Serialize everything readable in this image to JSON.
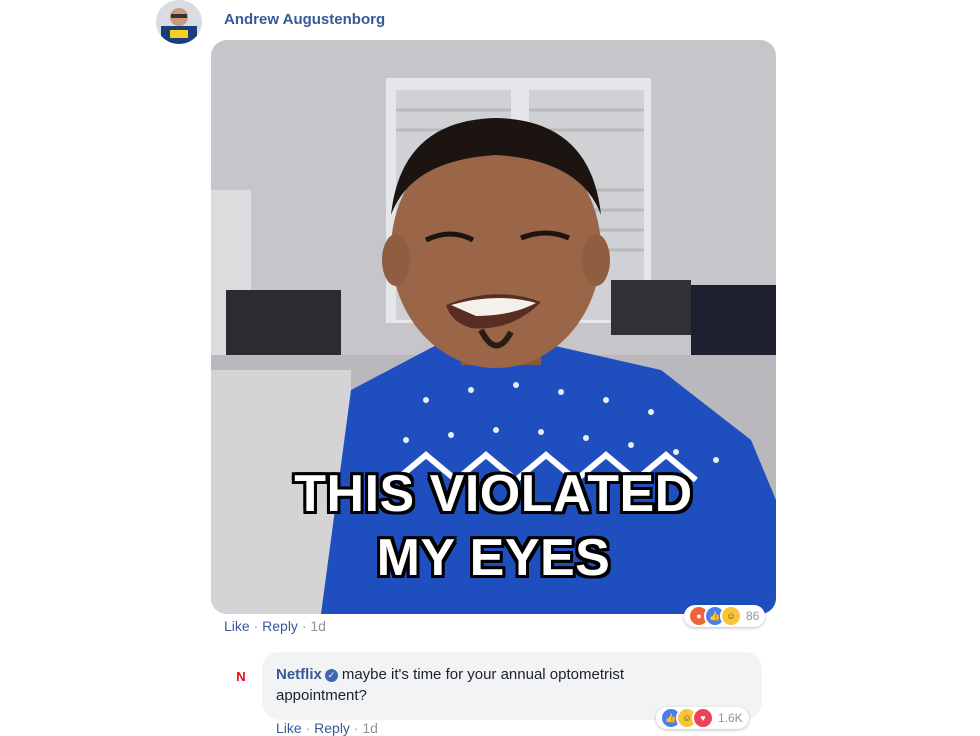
{
  "comment": {
    "author": "Andrew Augustenborg",
    "gif_caption_line1": "THIS VIOLATED",
    "gif_caption_line2": "MY EYES",
    "actions": {
      "like": "Like",
      "reply": "Reply",
      "time": "1d",
      "sep": "·"
    },
    "reactions": {
      "count": "86",
      "types": [
        "angry-icon",
        "like-icon",
        "haha-icon"
      ]
    }
  },
  "reply": {
    "author": "Netflix",
    "logo_letter": "N",
    "text": "maybe it's time for your annual optometrist appointment?",
    "actions": {
      "like": "Like",
      "reply": "Reply",
      "time": "1d",
      "sep": "·"
    },
    "reactions": {
      "count": "1.6K",
      "types": [
        "like-icon",
        "haha-icon",
        "love-icon"
      ]
    }
  },
  "colors": {
    "link": "#385898",
    "meta": "#90949c",
    "bubble": "#f2f3f5",
    "sweater": "#1f4fbf"
  }
}
